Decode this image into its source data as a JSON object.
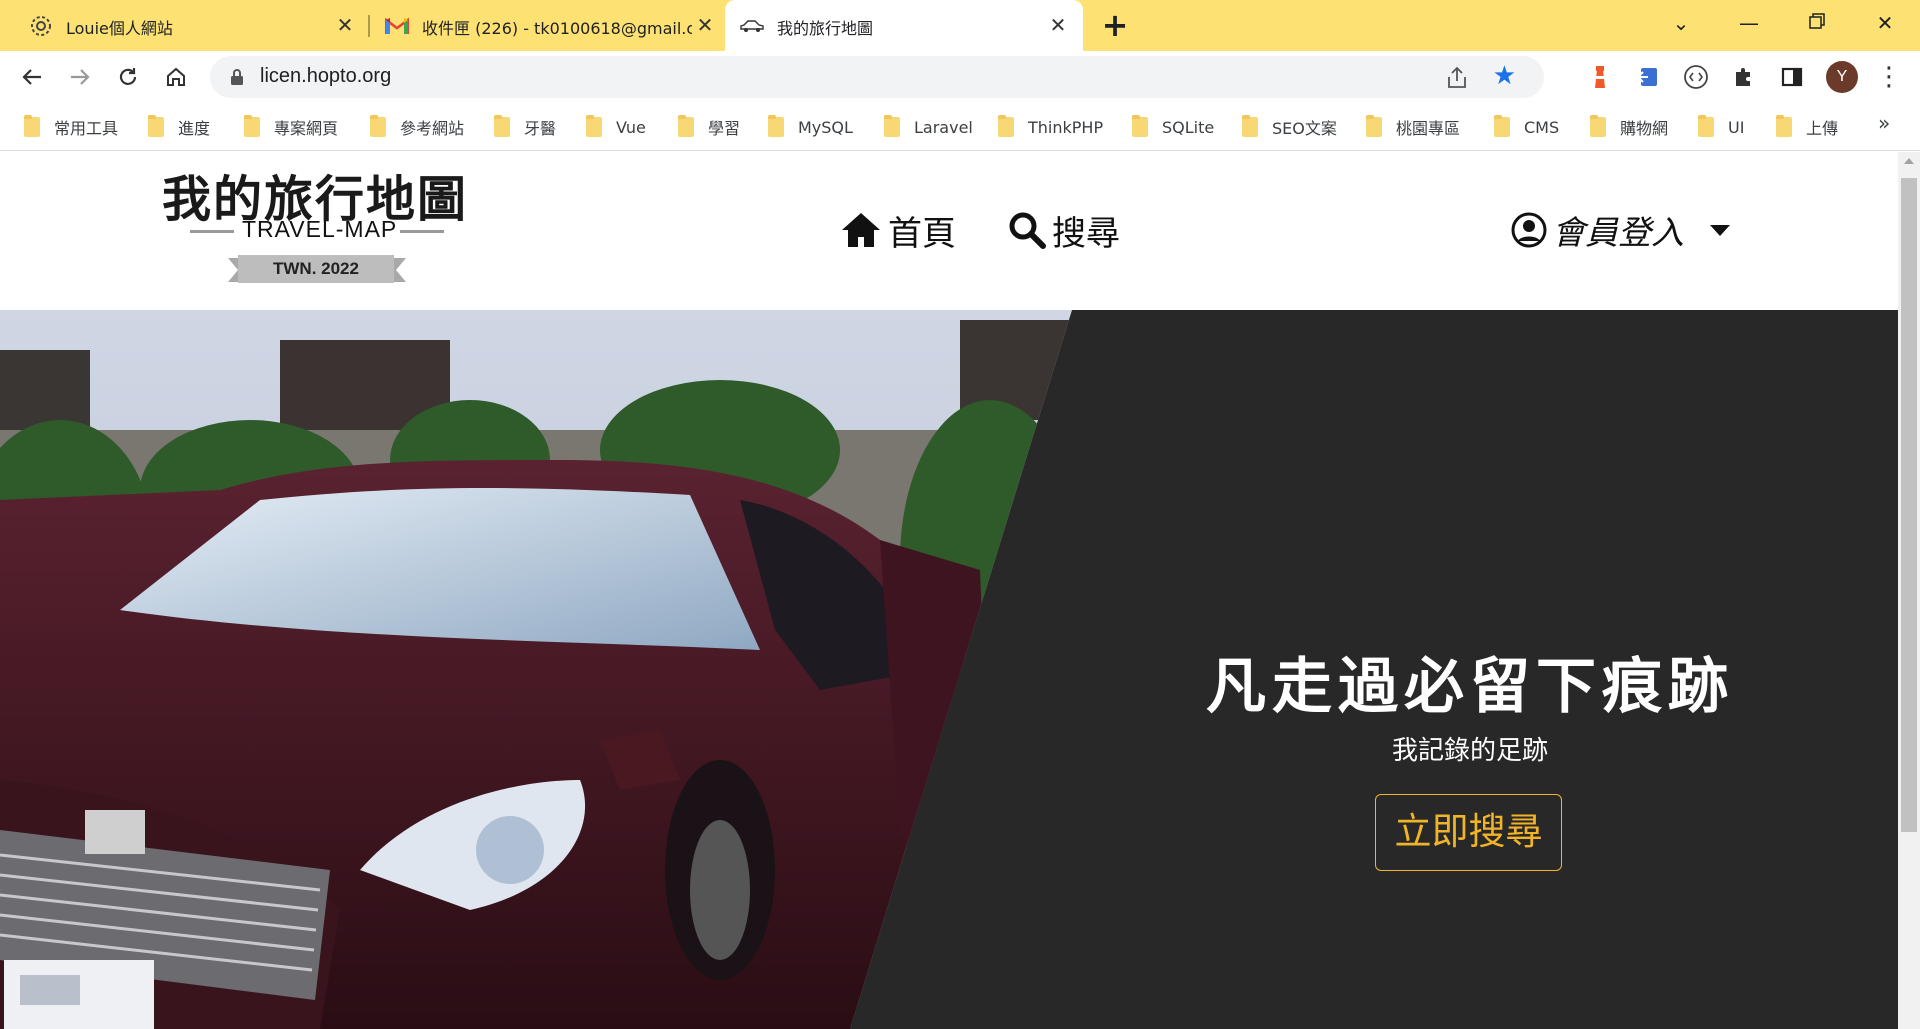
{
  "browser": {
    "tabs": [
      {
        "title": "Louie個人網站",
        "icon": "gear-icon"
      },
      {
        "title": "收件匣 (226) - tk0100618@gmail.c",
        "icon": "gmail-icon"
      },
      {
        "title": "我的旅行地圖",
        "icon": "car-icon"
      }
    ],
    "url": "licen.hopto.org",
    "profile_initial": "Y",
    "bookmarks": [
      "常用工具",
      "進度",
      "專案網頁",
      "參考網站",
      "牙醫",
      "Vue",
      "學習",
      "MySQL",
      "Laravel",
      "ThinkPHP",
      "SQLite",
      "SEO文案",
      "桃園專區",
      "CMS",
      "購物網",
      "UI",
      "上傳"
    ],
    "bookmarks_overflow": "»"
  },
  "site": {
    "logo_title": "我的旅行地圖",
    "logo_subtitle": "TRAVEL-MAP",
    "logo_badge": "TWN. 2022",
    "nav": {
      "home": "首頁",
      "search": "搜尋",
      "login": "會員登入"
    },
    "hero": {
      "title": "凡走過必留下痕跡",
      "subtitle": "我記錄的足跡",
      "button": "立即搜尋"
    }
  },
  "colors": {
    "tab_bar": "#fde172",
    "hero_bg": "#282828",
    "accent": "#f0b429"
  }
}
